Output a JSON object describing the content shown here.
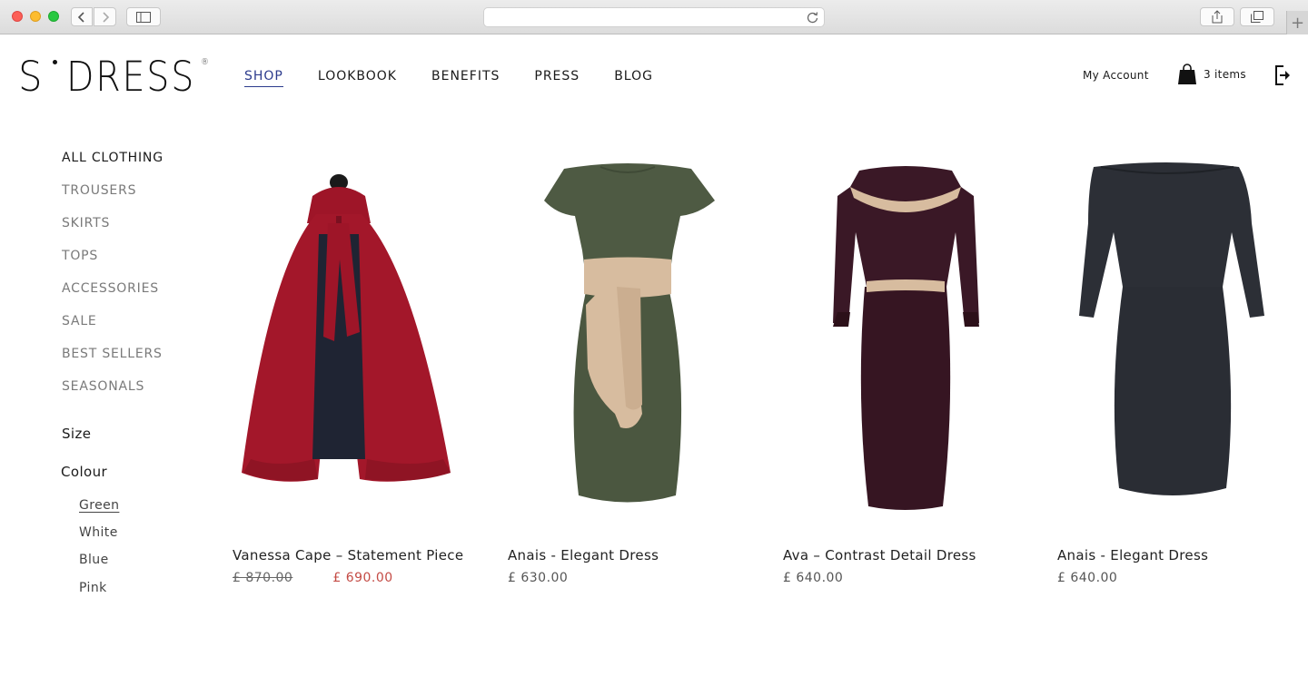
{
  "browser": {
    "icons": [
      "back-icon",
      "forward-icon",
      "sidebar-icon",
      "reload-icon",
      "share-icon",
      "tabs-icon",
      "new-tab-icon"
    ],
    "new_tab_glyph": "+"
  },
  "brand": {
    "logo_s": "S",
    "logo_word": "DRESS",
    "logo_reg": "®"
  },
  "nav": {
    "items": [
      {
        "label": "SHOP",
        "active": true
      },
      {
        "label": "LOOKBOOK",
        "active": false
      },
      {
        "label": "BENEFITS",
        "active": false
      },
      {
        "label": "PRESS",
        "active": false
      },
      {
        "label": "BLOG",
        "active": false
      }
    ]
  },
  "header": {
    "account_label": "My Account",
    "cart_label": "3 items"
  },
  "sidebar": {
    "categories": [
      {
        "label": "ALL CLOTHING",
        "active": true
      },
      {
        "label": "TROUSERS",
        "active": false
      },
      {
        "label": "SKIRTS",
        "active": false
      },
      {
        "label": "TOPS",
        "active": false
      },
      {
        "label": "ACCESSORIES",
        "active": false
      },
      {
        "label": "SALE",
        "active": false
      },
      {
        "label": "BEST SELLERS",
        "active": false
      },
      {
        "label": "SEASONALS",
        "active": false
      }
    ],
    "size_label": "Size",
    "colour_label": "Colour",
    "colours": [
      {
        "label": "Green",
        "selected": true
      },
      {
        "label": "White",
        "selected": false
      },
      {
        "label": "Blue",
        "selected": false
      },
      {
        "label": "Pink",
        "selected": false
      }
    ]
  },
  "products": [
    {
      "name": "Vanessa Cape – Statement Piece",
      "old_price": "£ 870.00",
      "price": "£ 690.00",
      "on_sale": true
    },
    {
      "name": "Anais - Elegant Dress",
      "price": "£ 630.00",
      "on_sale": false
    },
    {
      "name": "Ava – Contrast Detail Dress",
      "price": "£ 640.00",
      "on_sale": false
    },
    {
      "name": "Anais - Elegant Dress",
      "price": "£ 640.00",
      "on_sale": false
    }
  ],
  "colors": {
    "nav_active": "#2c3b8d",
    "sale_price": "#c44b45",
    "cape_red": "#a3172a",
    "dress_green": "#4e5a43",
    "belt_beige": "#d7bc9f",
    "dress_plum": "#3a1826",
    "dress_charcoal": "#2c2f36"
  }
}
